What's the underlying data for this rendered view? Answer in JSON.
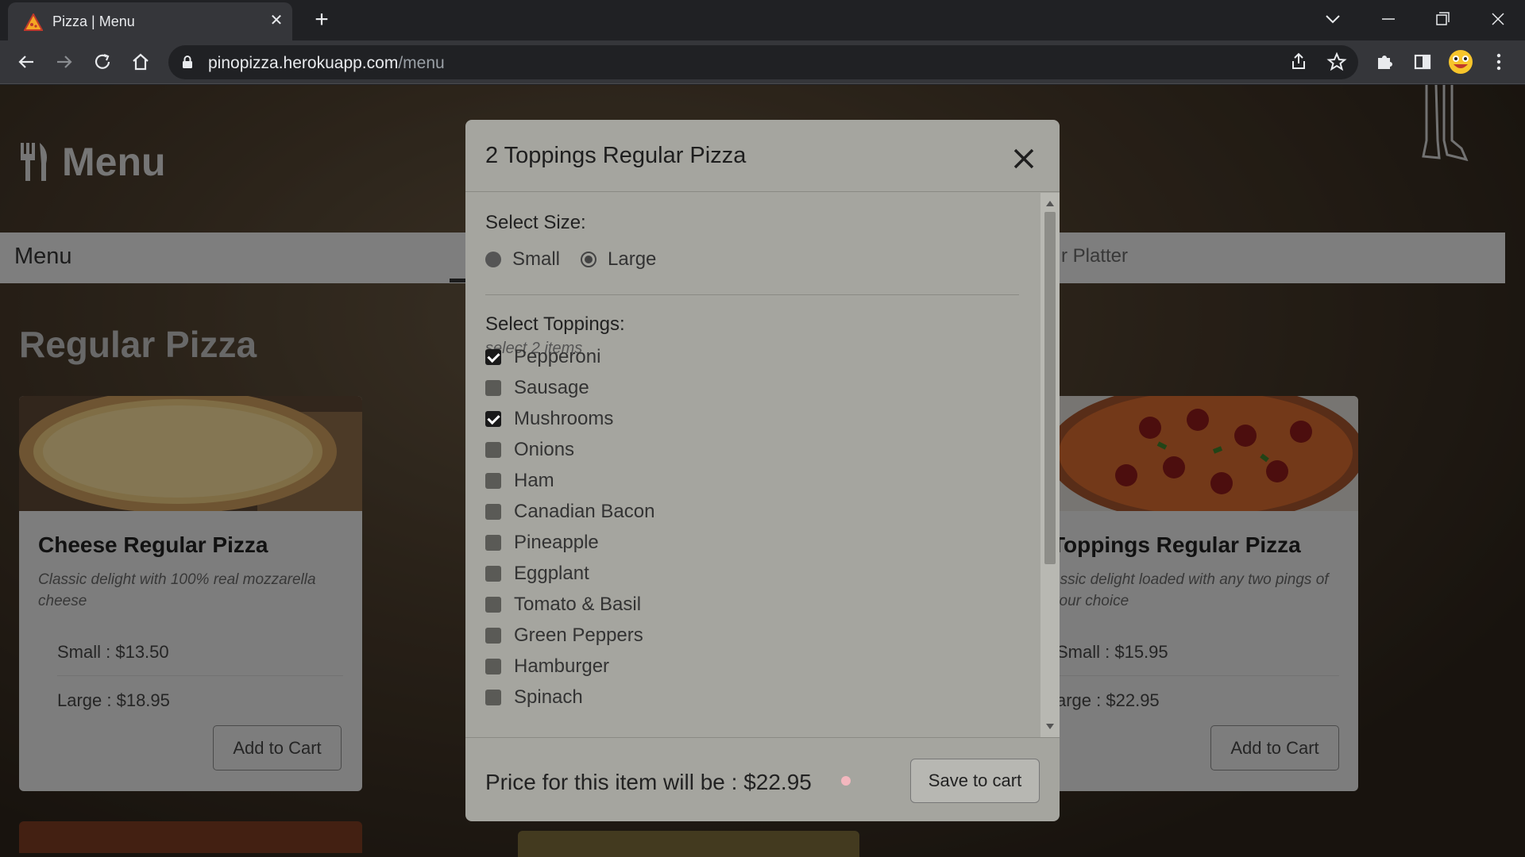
{
  "browser": {
    "tab_title": "Pizza | Menu",
    "url_host": "pinopizza.herokuapp.com",
    "url_path": "/menu"
  },
  "page": {
    "hero_title": "Menu",
    "menubar_label": "Menu",
    "menubar_partial_tab": "r Platter",
    "section_title": "Regular Pizza",
    "cards": [
      {
        "name": "Cheese Regular Pizza",
        "description": "Classic delight with 100% real mozzarella cheese",
        "small_price": "Small : $13.50",
        "large_price": "Large : $18.95",
        "button": "Add to Cart"
      },
      {
        "name": "Toppings Regular Pizza",
        "description": "assic delight loaded with any two pings of your choice",
        "small_price": "Small : $15.95",
        "large_price": "arge : $22.95",
        "button": "Add to Cart"
      }
    ]
  },
  "modal": {
    "title": "2 Toppings Regular Pizza",
    "size_label": "Select Size:",
    "sizes": [
      {
        "label": "Small",
        "selected": false
      },
      {
        "label": "Large",
        "selected": true
      }
    ],
    "toppings_label": "Select Toppings:",
    "toppings_hint": "select 2 items",
    "toppings": [
      {
        "label": "Pepperoni",
        "checked": true
      },
      {
        "label": "Sausage",
        "checked": false
      },
      {
        "label": "Mushrooms",
        "checked": true
      },
      {
        "label": "Onions",
        "checked": false
      },
      {
        "label": "Ham",
        "checked": false
      },
      {
        "label": "Canadian Bacon",
        "checked": false
      },
      {
        "label": "Pineapple",
        "checked": false
      },
      {
        "label": "Eggplant",
        "checked": false
      },
      {
        "label": "Tomato & Basil",
        "checked": false
      },
      {
        "label": "Green Peppers",
        "checked": false
      },
      {
        "label": "Hamburger",
        "checked": false
      },
      {
        "label": "Spinach",
        "checked": false
      }
    ],
    "price_text": "Price for this item will be : $22.95",
    "save_button": "Save to cart"
  },
  "colors": {
    "modal_bg": "#a5a59f",
    "chrome_dark": "#202124",
    "price_dot": "#f3b7be"
  },
  "icons": [
    "pizza-favicon",
    "close-icon",
    "plus-icon",
    "back-icon",
    "forward-icon",
    "reload-icon",
    "home-icon",
    "lock-icon",
    "share-icon",
    "star-icon",
    "puzzle-icon",
    "sidepanel-icon",
    "avatar-icon",
    "kebab-menu-icon",
    "utensils-icon"
  ]
}
